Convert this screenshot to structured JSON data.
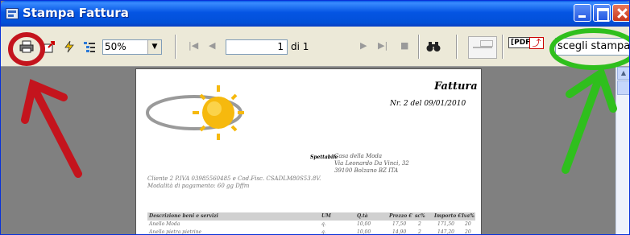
{
  "window": {
    "title": "Stampa Fattura"
  },
  "toolbar": {
    "zoom_value": "50%",
    "page_number": "1",
    "page_of": "di 1",
    "pdf_label": "[PDF]",
    "printer_label": "scegli stampante"
  },
  "invoice": {
    "title": "Fattura",
    "number_line": "Nr. 2 del 09/01/2010",
    "recipient_tag": "Spettabile",
    "recipient_lines": [
      "Casa della Moda",
      "Via Leonardo Da Vinci, 32",
      "39100 Bolzano BZ ITA"
    ],
    "client_lines": [
      "Cliente 2 P.IVA 03985560485 e Cod.Fisc. CSADLM80S53.8V.",
      "Modalità di pagamento: 60 gg Dffm"
    ],
    "table": {
      "headers": [
        "Descrizione beni e servizi",
        "UM",
        "Q.tà",
        "Prezzo €",
        "sc%",
        "Importo €",
        "Iva%"
      ],
      "rows": [
        [
          "Anello Moda",
          "q.",
          "10,00",
          "17,50",
          "2",
          "171,50",
          "20"
        ],
        [
          "Anello pietra pietrine",
          "q.",
          "10,00",
          "14,90",
          "2",
          "147,20",
          "20"
        ]
      ]
    }
  },
  "colors": {
    "annotation_red": "#c4141d",
    "annotation_green": "#2fbf1d",
    "titlebar": "#0555e3",
    "sun": "#f6b90e"
  }
}
